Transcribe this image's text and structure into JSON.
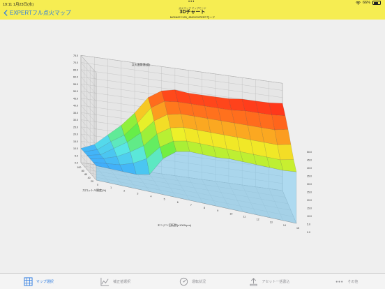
{
  "status": {
    "time": "19:11",
    "date": "1月23日(水)",
    "dots": "•••",
    "battery": "66%",
    "battery_level": 0.66
  },
  "nav": {
    "back_label": "EXPERTフル点火マップ",
    "supertitle": "点火マップ マップモード",
    "title": "3Dチャート",
    "subtitle": "MONKEY125_JB03 EXPERTモード"
  },
  "tabs": [
    {
      "label": "マップ選択",
      "icon": "grid-icon",
      "active": true
    },
    {
      "label": "補正値選択",
      "icon": "line-chart-icon",
      "active": false
    },
    {
      "label": "運転状況",
      "icon": "gauge-icon",
      "active": false
    },
    {
      "label": "アセットー括書込",
      "icon": "upload-icon",
      "active": false
    },
    {
      "label": "その他",
      "icon": "more-icon",
      "active": false
    }
  ],
  "colors": {
    "header_bg": "#f6ed52",
    "accent": "#2f7de1",
    "surface_low": "#3aa0ff",
    "surface_mid": "#66ee44",
    "surface_high": "#ff2a1a"
  },
  "chart_data": {
    "type": "surface3d",
    "title": "点火進角値(度)",
    "xlabel": "エンジン回転数(x1000rpm)",
    "ylabel": "スロットル開度(%)",
    "zlabel": "",
    "x_ticks": [
      "0",
      "1",
      "2",
      "3",
      "4",
      "5",
      "6",
      "7",
      "8",
      "9",
      "10",
      "11",
      "12",
      "13",
      "14",
      "15"
    ],
    "y_ticks": [
      "100",
      "80",
      "60",
      "40",
      "20"
    ],
    "z_ticks_left": [
      "75.0",
      "70.0",
      "65.0",
      "60.0",
      "55.0",
      "50.0",
      "45.0",
      "40.0",
      "35.0",
      "30.0",
      "25.0",
      "20.0",
      "15.0",
      "10.0",
      "5.0",
      "0.0"
    ],
    "z_ticks_right": [
      "50.0",
      "45.0",
      "40.0",
      "35.0",
      "30.0",
      "25.0",
      "20.0",
      "15.0",
      "10.0",
      "5.0",
      "0.0"
    ],
    "zlim": [
      0,
      75
    ],
    "x": [
      0,
      1,
      2,
      3,
      4,
      5,
      6,
      7,
      8,
      9,
      10,
      11,
      12,
      13,
      14,
      15
    ],
    "y": [
      100,
      80,
      60,
      40,
      20,
      0
    ],
    "grid": true,
    "series": [
      {
        "values": [
          10,
          10,
          10,
          10,
          12,
          25,
          32,
          34,
          34,
          34,
          35,
          35,
          35,
          35,
          35,
          36
        ]
      },
      {
        "values": [
          10,
          11,
          12,
          15,
          20,
          30,
          36,
          38,
          38,
          38,
          38,
          38,
          38,
          38,
          38,
          40
        ]
      },
      {
        "values": [
          10,
          12,
          15,
          20,
          26,
          36,
          42,
          44,
          44,
          44,
          44,
          44,
          44,
          44,
          44,
          46
        ]
      },
      {
        "values": [
          10,
          12,
          18,
          24,
          32,
          42,
          48,
          50,
          50,
          50,
          50,
          50,
          50,
          50,
          50,
          52
        ]
      },
      {
        "values": [
          10,
          13,
          20,
          26,
          36,
          48,
          54,
          55,
          55,
          55,
          55,
          55,
          56,
          56,
          56,
          57
        ]
      },
      {
        "values": [
          10,
          14,
          22,
          30,
          40,
          52,
          58,
          60,
          59,
          59,
          59,
          59,
          60,
          60,
          60,
          61
        ]
      }
    ]
  }
}
